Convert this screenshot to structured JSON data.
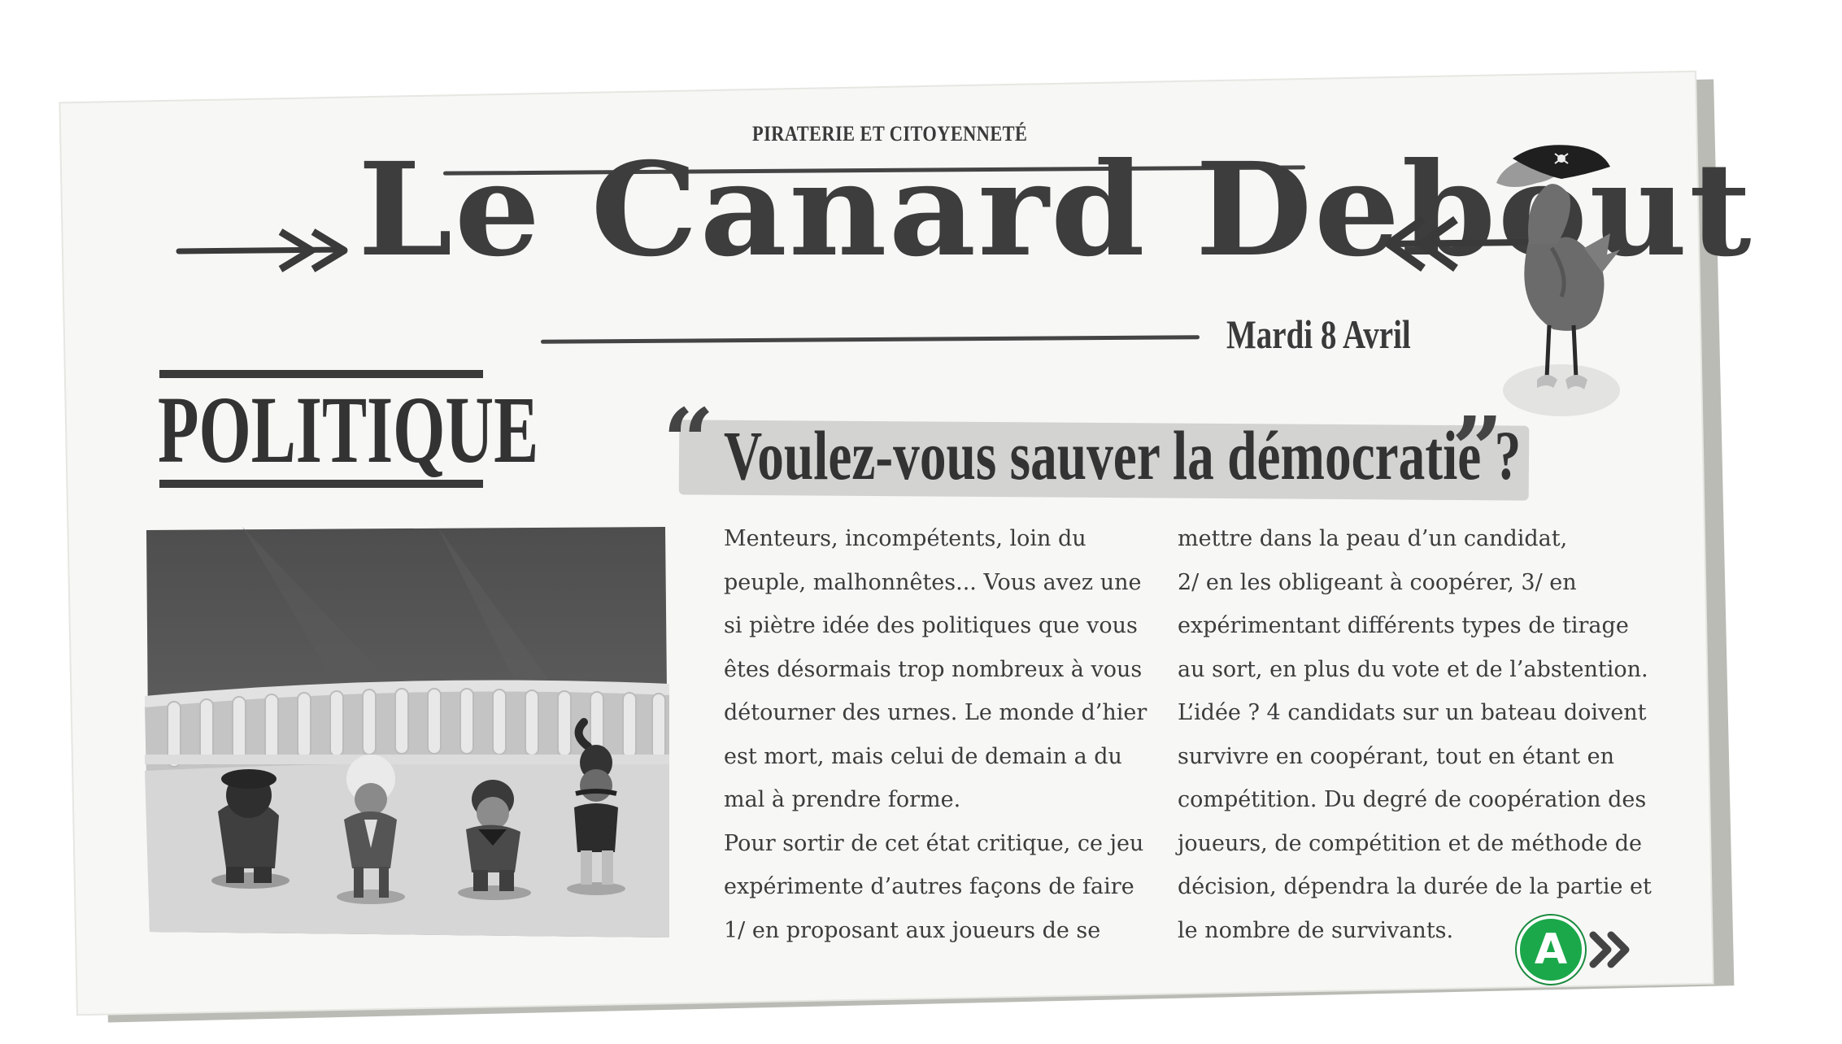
{
  "newspaper": {
    "kicker": "PIRATERIE ET CITOYENNETÉ",
    "name": "Le Canard Debout",
    "date": "Mardi 8 Avril"
  },
  "section": {
    "title": "POLITIQUE"
  },
  "article": {
    "headline": "Voulez-vous sauver la démocratie ?",
    "open_quote": "“",
    "close_quote": "”",
    "column_1": [
      "Menteurs, incompétents, loin du",
      "peuple, malhonnêtes... Vous avez une",
      "si piètre idée des politiques que vous",
      "êtes désormais trop nombreux à vous",
      "détourner des urnes. Le monde d’hier",
      "est mort, mais celui de demain a du",
      "mal à prendre forme.",
      "Pour sortir de cet état critique, ce jeu",
      "expérimente d’autres façons de faire",
      "1/ en proposant aux joueurs de se"
    ],
    "column_2": [
      "mettre dans la peau d’un candidat,",
      "2/ en les obligeant à coopérer, 3/ en",
      "expérimentant différents types de tirage",
      "au sort, en plus du vote et de l’abstention.",
      "L’idée ? 4 candidats sur un bateau doivent",
      "survivre en coopérant, tout en étant en",
      "compétition. Du degré de coopération des",
      "joueurs, de compétition et de méthode de",
      "décision, dépendra la durée de la partie et",
      "le nombre de survivants."
    ]
  },
  "controls": {
    "next_button_label": "A",
    "next_button_color": "#1ba84a"
  },
  "icons": [
    "arrow-right-icon",
    "arrow-left-icon",
    "pirate-duck-mascot",
    "double-chevron-right-icon"
  ]
}
